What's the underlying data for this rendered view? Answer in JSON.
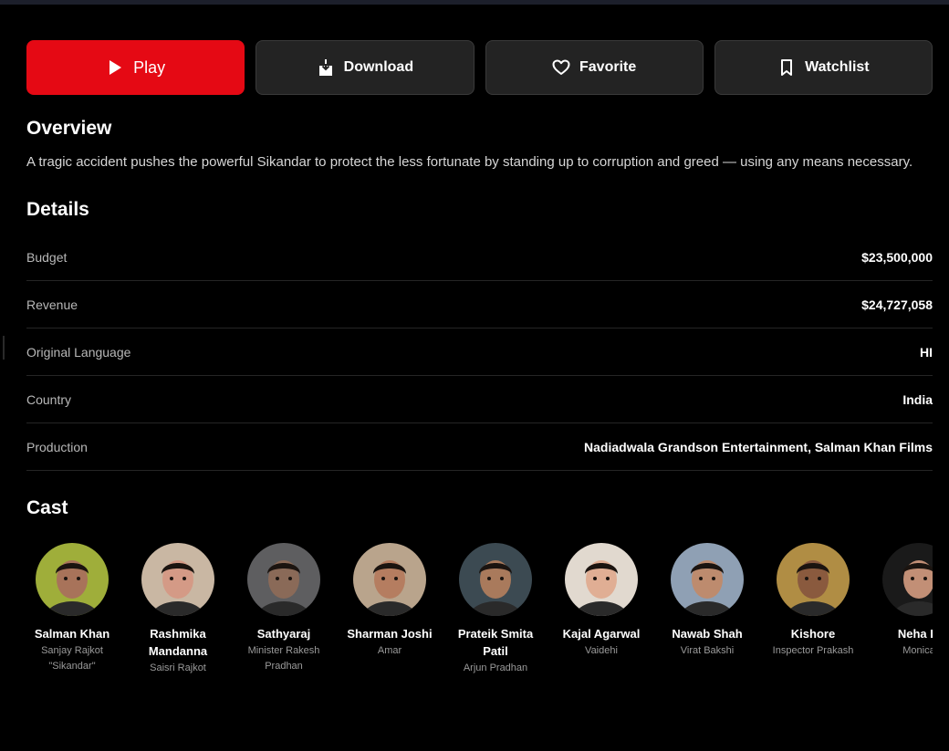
{
  "actions": {
    "play": "Play",
    "download": "Download",
    "favorite": "Favorite",
    "watchlist": "Watchlist"
  },
  "overview": {
    "title": "Overview",
    "text": "A tragic accident pushes the powerful Sikandar to protect the less fortunate by standing up to corruption and greed — using any means necessary."
  },
  "details": {
    "title": "Details",
    "rows": [
      {
        "label": "Budget",
        "value": "$23,500,000"
      },
      {
        "label": "Revenue",
        "value": "$24,727,058"
      },
      {
        "label": "Original Language",
        "value": "HI"
      },
      {
        "label": "Country",
        "value": "India"
      },
      {
        "label": "Production",
        "value": "Nadiadwala Grandson Entertainment, Salman Khan Films"
      }
    ]
  },
  "cast": {
    "title": "Cast",
    "members": [
      {
        "name": "Salman Khan",
        "role": "Sanjay Rajkot \"Sikandar\"",
        "bg": "#9fae3a",
        "skin": "#a8735a"
      },
      {
        "name": "Rashmika Mandanna",
        "role": "Saisri Rajkot",
        "bg": "#c9b7a3",
        "skin": "#d49a86"
      },
      {
        "name": "Sathyaraj",
        "role": "Minister Rakesh Pradhan",
        "bg": "#5e5e60",
        "skin": "#8a6a58"
      },
      {
        "name": "Sharman Joshi",
        "role": "Amar",
        "bg": "#b9a48c",
        "skin": "#b57d60"
      },
      {
        "name": "Prateik Smita Patil",
        "role": "Arjun Pradhan",
        "bg": "#3c4a52",
        "skin": "#a97a5c"
      },
      {
        "name": "Kajal Agarwal",
        "role": "Vaidehi",
        "bg": "#e1d9cf",
        "skin": "#e0ae94"
      },
      {
        "name": "Nawab Shah",
        "role": "Virat Bakshi",
        "bg": "#8fa0b4",
        "skin": "#bd8b6e"
      },
      {
        "name": "Kishore",
        "role": "Inspector Prakash",
        "bg": "#b08d44",
        "skin": "#8a5a3e"
      },
      {
        "name": "Neha Iy",
        "role": "Monica",
        "bg": "#1a1a1a",
        "skin": "#c28f76"
      }
    ]
  },
  "colors": {
    "accent": "#e50914",
    "button_bg": "#232323",
    "background": "#000000"
  },
  "icons": {
    "play": "play-icon",
    "download": "download-icon",
    "favorite": "heart-icon",
    "watchlist": "bookmark-icon"
  }
}
